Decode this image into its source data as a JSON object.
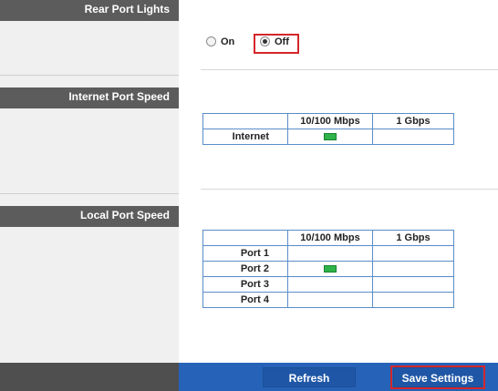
{
  "sidebar": {
    "rear_port_lights": "Rear Port Lights",
    "internet_port_speed": "Internet Port Speed",
    "local_port_speed": "Local Port Speed"
  },
  "rear_lights": {
    "on_label": "On",
    "off_label": "Off",
    "selected": "Off"
  },
  "internet_table": {
    "headers": [
      "",
      "10/100 Mbps",
      "1 Gbps"
    ],
    "rows": [
      {
        "label": "Internet",
        "speed_10_100": true,
        "speed_1g": false
      }
    ]
  },
  "local_table": {
    "headers": [
      "",
      "10/100 Mbps",
      "1 Gbps"
    ],
    "rows": [
      {
        "label": "Port 1",
        "speed_10_100": false,
        "speed_1g": false
      },
      {
        "label": "Port 2",
        "speed_10_100": true,
        "speed_1g": false
      },
      {
        "label": "Port 3",
        "speed_10_100": false,
        "speed_1g": false
      },
      {
        "label": "Port 4",
        "speed_10_100": false,
        "speed_1g": false
      }
    ]
  },
  "footer": {
    "refresh_label": "Refresh",
    "save_label": "Save Settings"
  },
  "colors": {
    "sidebar_header": "#5c5c5c",
    "footer_blue": "#2663b8",
    "highlight_red": "#d4262b",
    "led_green": "#2fb34a",
    "table_border": "#5a8dc8"
  }
}
